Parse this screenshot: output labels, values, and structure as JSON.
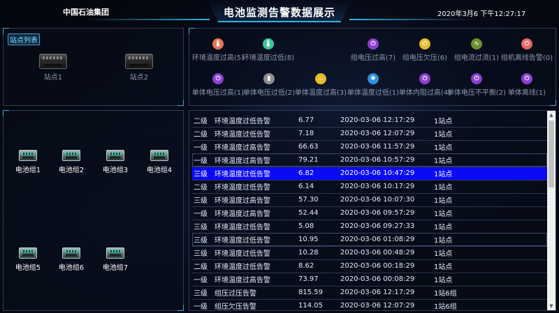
{
  "header": {
    "company": "中国石油集团",
    "title": "电池监测告警数据展示",
    "datetime": "2020年3月6 下午12:27:17"
  },
  "stations": {
    "tag": "站点列表",
    "items": [
      {
        "label": "站点1"
      },
      {
        "label": "站点2"
      }
    ]
  },
  "alarm_types": [
    {
      "label": "环境温度过高(5)",
      "icon": "thermometer-high-icon",
      "color": "#e8745a",
      "glyph": "🌡"
    },
    {
      "label": "环境温度过低(8)",
      "icon": "thermometer-low-icon",
      "color": "#3cc69a",
      "glyph": "🌡"
    },
    {
      "label": "组电压过高(7)",
      "icon": "power-high-icon",
      "color": "#8a3fd1",
      "glyph": "⏻"
    },
    {
      "label": "组电压欠压(6)",
      "icon": "power-low-icon",
      "color": "#e8b92a",
      "glyph": "⏻"
    },
    {
      "label": "组电流过流(1)",
      "icon": "current-wave-icon",
      "color": "#6f8f2c",
      "glyph": "∿"
    },
    {
      "label": "组机离线告警(0)",
      "icon": "offline-icon",
      "color": "#e86464",
      "glyph": "⏻"
    },
    {
      "label": "单体电压过高(1)",
      "icon": "cell-power-high-icon",
      "color": "#8a3fd1",
      "glyph": "⏻"
    },
    {
      "label": "单体电压过低(2)",
      "icon": "cell-battery-icon",
      "color": "#8e8e8e",
      "glyph": "▮"
    },
    {
      "label": "单体温度过高(3)",
      "icon": "fire-icon",
      "color": "#e8b92a",
      "glyph": "♨"
    },
    {
      "label": "单体温度过低(1)",
      "icon": "snowflake-icon",
      "color": "#2e8fe0",
      "glyph": "✱"
    },
    {
      "label": "单体内阻过高(4)",
      "icon": "resistance-icon",
      "color": "#8a3fd1",
      "glyph": "⏻"
    },
    {
      "label": "单体电压不平衡(2)",
      "icon": "imbalance-icon",
      "color": "#8a3fd1",
      "glyph": "⏻"
    },
    {
      "label": "单体离线(1)",
      "icon": "cell-offline-icon",
      "color": "#8a3fd1",
      "glyph": "⏻"
    }
  ],
  "groups": [
    {
      "label": "电池组1"
    },
    {
      "label": "电池组2"
    },
    {
      "label": "电池组3"
    },
    {
      "label": "电池组4"
    },
    {
      "label": "电池组5"
    },
    {
      "label": "电池组6"
    },
    {
      "label": "电池组7"
    }
  ],
  "alarms": [
    {
      "level": "二级",
      "type": "环境温度过低告警",
      "value": "6.77",
      "time": "2020-03-06 12:17:29",
      "location": "1站点"
    },
    {
      "level": "二级",
      "type": "环境温度过低告警",
      "value": "7.18",
      "time": "2020-03-06 12:07:29",
      "location": "1站点"
    },
    {
      "level": "一级",
      "type": "环境温度过高告警",
      "value": "66.63",
      "time": "2020-03-06 11:57:29",
      "location": "1站点"
    },
    {
      "level": "一级",
      "type": "环境温度过高告警",
      "value": "79.21",
      "time": "2020-03-06 10:57:29",
      "location": "1站点"
    },
    {
      "level": "三级",
      "type": "环境温度过低告警",
      "value": "6.82",
      "time": "2020-03-06 10:47:29",
      "location": "1站点"
    },
    {
      "level": "二级",
      "type": "环境温度过低告警",
      "value": "6.14",
      "time": "2020-03-06 10:17:29",
      "location": "1站点"
    },
    {
      "level": "三级",
      "type": "环境温度过高告警",
      "value": "57.30",
      "time": "2020-03-06 10:07:30",
      "location": "1站点"
    },
    {
      "level": "一级",
      "type": "环境温度过高告警",
      "value": "52.44",
      "time": "2020-03-06 09:57:29",
      "location": "1站点"
    },
    {
      "level": "三级",
      "type": "环境温度过低告警",
      "value": "5.08",
      "time": "2020-03-06 09:27:33",
      "location": "1站点"
    },
    {
      "level": "三级",
      "type": "环境温度过低告警",
      "value": "10.95",
      "time": "2020-03-06 01:08:29",
      "location": "1站点"
    },
    {
      "level": "三级",
      "type": "环境温度过低告警",
      "value": "10.28",
      "time": "2020-03-06 00:48:29",
      "location": "1站点"
    },
    {
      "level": "二级",
      "type": "环境温度过低告警",
      "value": "8.62",
      "time": "2020-03-06 00:18:29",
      "location": "1站点"
    },
    {
      "level": "一级",
      "type": "环境温度过高告警",
      "value": "73.97",
      "time": "2020-03-06 00:08:29",
      "location": "1站点"
    },
    {
      "level": "三级",
      "type": "组压过压告警",
      "value": "815.59",
      "time": "2020-03-06 12:17:29",
      "location": "1站6组"
    },
    {
      "level": "一级",
      "type": "组压欠压告警",
      "value": "114.05",
      "time": "2020-03-06 12:07:29",
      "location": "1站6组"
    }
  ],
  "selected_alarm_index": 4
}
